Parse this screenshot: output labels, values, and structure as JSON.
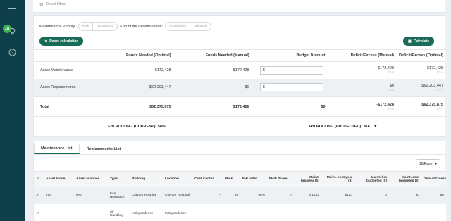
{
  "sidebar": {
    "badge_count": "18",
    "icons": [
      "menu-icon",
      "lightbulb-icon",
      "help-icon"
    ]
  },
  "filters": {
    "reset_filters_label": "Reset filters"
  },
  "priority": {
    "maintenance_label": "Maintenance Priority:",
    "maintenance_options": [
      "Risk",
      "Normalized"
    ],
    "eol_label": "End of life determination:",
    "eol_options": [
      "Straightline",
      "Adjusted"
    ]
  },
  "actions": {
    "reset_calculation": "Reset calculation",
    "calculate": "Calculate"
  },
  "funding_table": {
    "headers": [
      "",
      "Funds Needed (Optimal)",
      "Funds Needed (Manual)",
      "Budget Amount",
      "Deficit/Excess (Manual)",
      "Deficit/Excess (Optimal)"
    ],
    "rows": [
      {
        "label": "Asset Maintenance",
        "optimal": "$172,428",
        "manual": "$172,428",
        "budget_prefix": "$",
        "deficit_manual": "-$172,428",
        "deficit_manual_pct": "(0%)",
        "deficit_optimal": "-$172,428",
        "deficit_optimal_pct": "(0%)"
      },
      {
        "label": "Asset Replacements",
        "optimal": "$62,203,447",
        "manual": "$0",
        "budget_prefix": "$",
        "deficit_manual": "$0",
        "deficit_manual_pct": "(0%)",
        "deficit_optimal": "-$62,203,447",
        "deficit_optimal_pct": "(0%)"
      },
      {
        "label": "Total",
        "optimal": "$62,375,875",
        "manual": "$172,428",
        "budget": "$0",
        "deficit_manual": "-$172,428",
        "deficit_manual_pct": "(0%)",
        "deficit_optimal": "-$62,375,875",
        "deficit_optimal_pct": "(0%)"
      }
    ]
  },
  "fhi": {
    "current": "FHI ROLLING (CURRENT): 58%",
    "projected": "FHI ROLLING (PROJECTED): N/A"
  },
  "tabs": [
    "Maintenance List",
    "Replacements List"
  ],
  "pagination": {
    "per_page": "10/Page"
  },
  "maintenance_table": {
    "headers": [
      "",
      "Asset Name",
      "Asset Number",
      "Type",
      "Building",
      "Location",
      "Cost Center",
      "Risk",
      "FHI index",
      "FHIE Score",
      "Maint. hrs/year (h)",
      "Maint. cost/year ($)",
      "Maint. hrs budgeted (h)",
      "Maint. cost budgeted (h)",
      "Deficit/Excess ($"
    ],
    "rows": [
      {
        "checked": "✓",
        "asset_name": "Fan",
        "asset_number": "test",
        "type": "Fan (Exhaust)",
        "building": "Clayton Hospital",
        "location": "Clayton Hospital",
        "cost_center": "--",
        "risk": "35",
        "fhi_index": "56%",
        "fhie_score": "4",
        "hrs_year": "3.1452",
        "cost_year": "$120",
        "hrs_budgeted": "0",
        "cost_budgeted": "$0",
        "deficit": "$0"
      },
      {
        "checked": "✓",
        "asset_name": "",
        "asset_number": "",
        "type": "Air Handling",
        "building": "Independence",
        "location": "Independence",
        "cost_center": "",
        "risk": "",
        "fhi_index": "",
        "fhie_score": "",
        "hrs_year": "",
        "cost_year": "",
        "hrs_budgeted": "",
        "cost_budgeted": "",
        "deficit": ""
      }
    ]
  },
  "colors": {
    "sidebar": "#0e3f4a",
    "accent": "#176b57",
    "badge": "#3fae55"
  }
}
